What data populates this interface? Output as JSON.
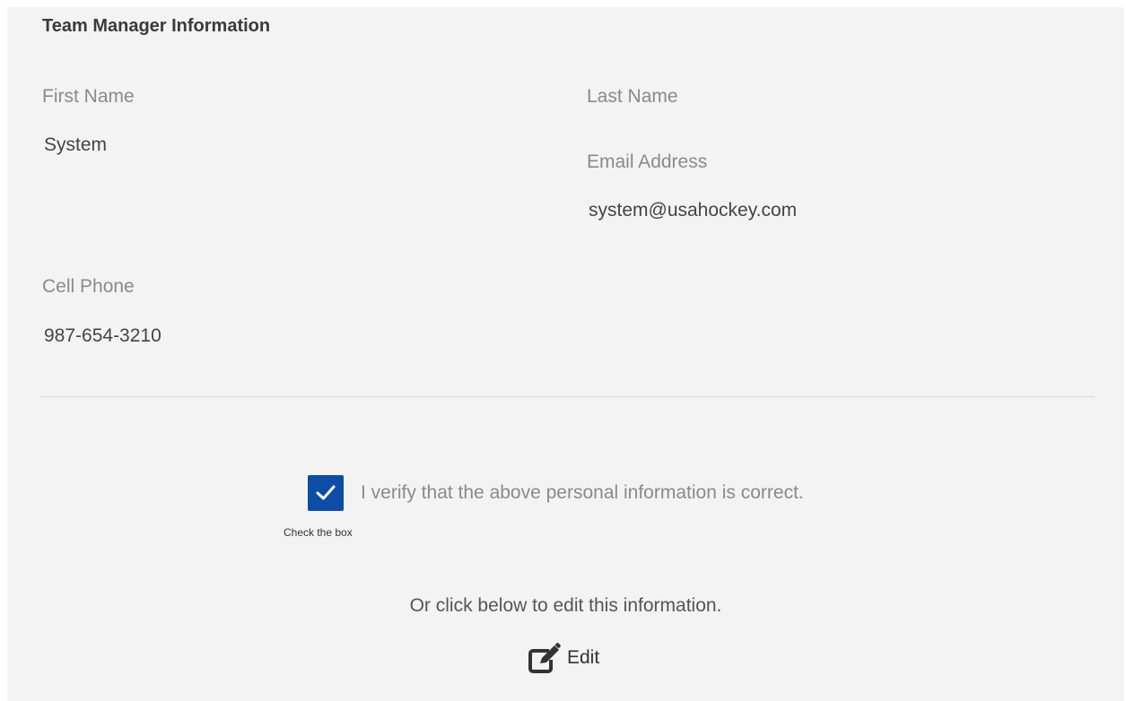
{
  "section": {
    "title": "Team Manager Information"
  },
  "fields": {
    "first_name": {
      "label": "First Name",
      "value": "System"
    },
    "last_name": {
      "label": "Last Name",
      "value": ""
    },
    "email": {
      "label": "Email Address",
      "value": "system@usahockey.com"
    },
    "cell_phone": {
      "label": "Cell Phone",
      "value": "987-654-3210"
    }
  },
  "verify": {
    "checked": true,
    "text": "I verify that the above personal information is correct.",
    "hint": "Check the box",
    "checkbox_color": "#0e4da6",
    "icon": "check-icon"
  },
  "edit": {
    "prompt": "Or click below to edit this information.",
    "label": "Edit",
    "icon": "edit-icon"
  }
}
